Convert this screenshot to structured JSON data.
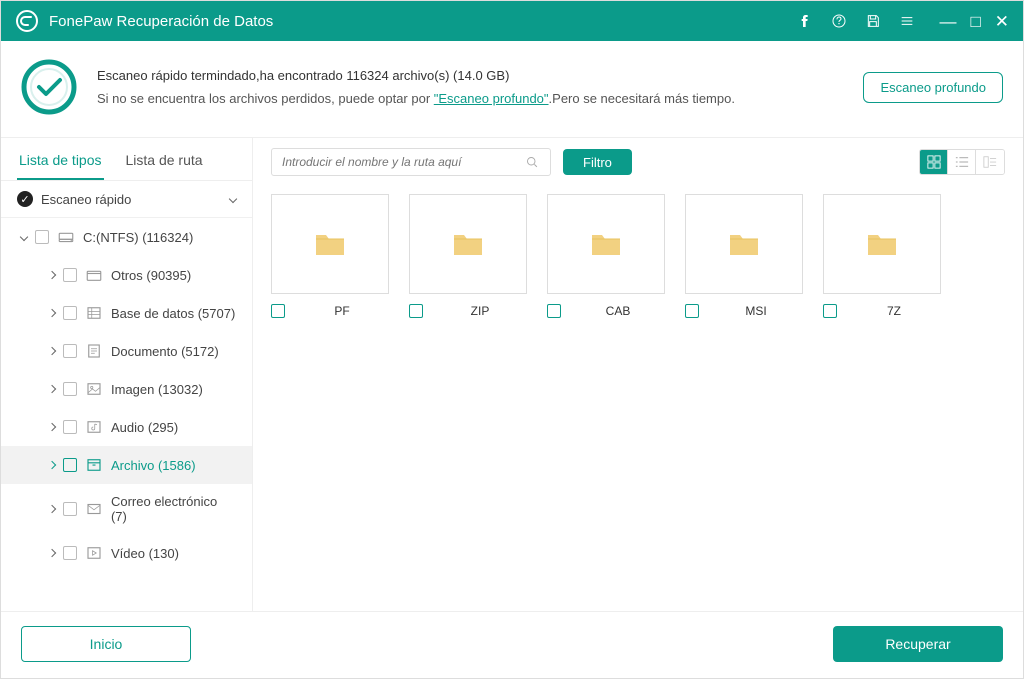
{
  "titlebar": {
    "app_title": "FonePaw Recuperación de Datos"
  },
  "banner": {
    "complete_msg": "Escaneo rápido termindado,ha encontrado 116324 archivo(s) (14.0 GB)",
    "notfound_prefix": "Si no se encuentra los archivos perdidos, puede optar por ",
    "deep_link": "\"Escaneo profundo\"",
    "notfound_suffix": ".Pero se necesitará más tiempo.",
    "deep_button": "Escaneo profundo"
  },
  "sidebar": {
    "tabs": [
      "Lista de tipos",
      "Lista de ruta"
    ],
    "scan_label": "Escaneo rápido",
    "root_label": "C:(NTFS) (116324)",
    "items": [
      {
        "label": "Otros (90395)"
      },
      {
        "label": "Base de datos (5707)"
      },
      {
        "label": "Documento (5172)"
      },
      {
        "label": "Imagen (13032)"
      },
      {
        "label": "Audio (295)"
      },
      {
        "label": "Archivo (1586)"
      },
      {
        "label": "Correo electrónico (7)"
      },
      {
        "label": "Vídeo (130)"
      }
    ]
  },
  "toolbar": {
    "search_placeholder": "Introducir el nombre y la ruta aquí",
    "filter_label": "Filtro"
  },
  "grid": {
    "items": [
      {
        "label": "PF"
      },
      {
        "label": "ZIP"
      },
      {
        "label": "CAB"
      },
      {
        "label": "MSI"
      },
      {
        "label": "7Z"
      }
    ]
  },
  "footer": {
    "home_label": "Inicio",
    "recover_label": "Recuperar"
  }
}
